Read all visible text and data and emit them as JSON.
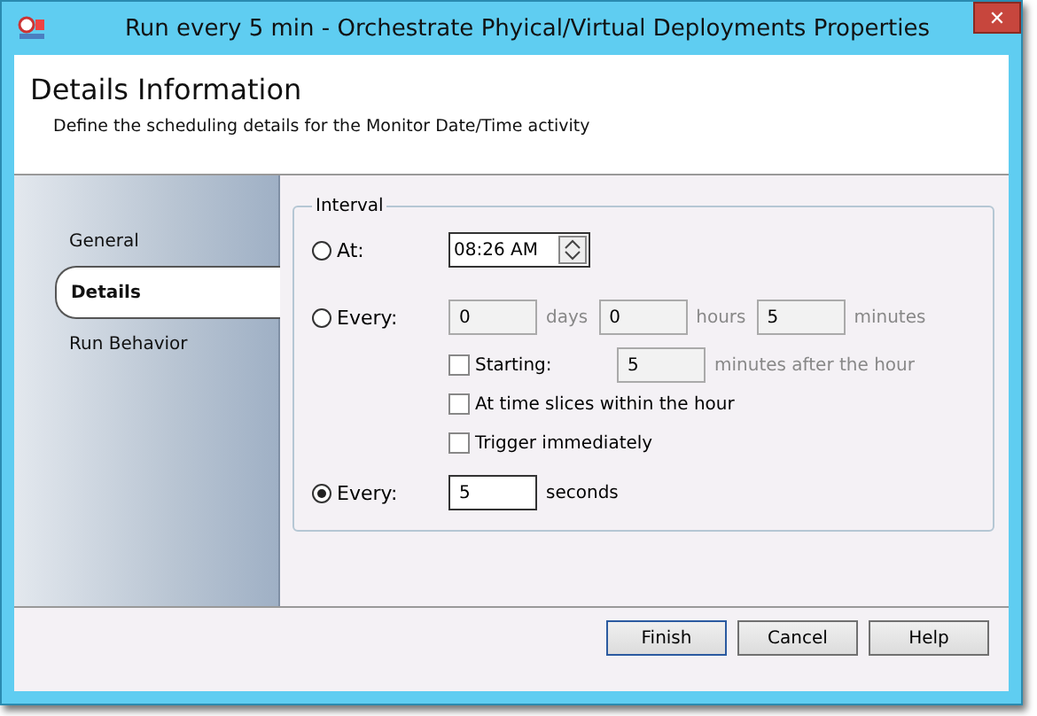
{
  "window": {
    "title": "Run every 5 min - Orchestrate Phyical/Virtual Deployments Properties",
    "close": "✕"
  },
  "header": {
    "title": "Details Information",
    "subtitle": "Define the scheduling details for the Monitor Date/Time activity"
  },
  "sidebar": {
    "items": [
      {
        "label": "General",
        "selected": false
      },
      {
        "label": "Details",
        "selected": true
      },
      {
        "label": "Run Behavior",
        "selected": false
      }
    ]
  },
  "interval": {
    "legend": "Interval",
    "options": [
      {
        "kind": "time",
        "label": "At:",
        "selected": false,
        "value": "08:26 AM"
      },
      {
        "kind": "period",
        "label": "Every:",
        "selected": false,
        "fields": [
          {
            "value": "0",
            "unit": "days",
            "disabled": true
          },
          {
            "value": "0",
            "unit": "hours",
            "disabled": true
          },
          {
            "value": "5",
            "unit": "minutes",
            "disabled": true
          }
        ],
        "checks": [
          {
            "label": "Starting:",
            "checked": false,
            "value": "5",
            "unit": "minutes after the hour",
            "disabled": true
          },
          {
            "label": "At time slices within the hour",
            "checked": false
          },
          {
            "label": "Trigger immediately",
            "checked": false
          }
        ]
      },
      {
        "kind": "seconds",
        "label": "Every:",
        "selected": true,
        "value": "5",
        "unit": "seconds"
      }
    ]
  },
  "buttons": [
    {
      "label": "Finish",
      "default": true
    },
    {
      "label": "Cancel",
      "default": false
    },
    {
      "label": "Help",
      "default": false
    }
  ]
}
